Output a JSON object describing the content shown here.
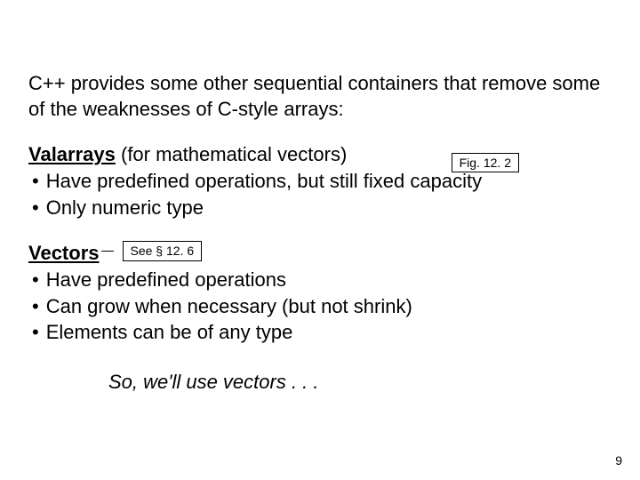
{
  "intro": "C++ provides some other sequential containers that remove some of the weaknesses of C-style arrays:",
  "fig_label": "Fig. 12. 2",
  "valarray": {
    "title": "Valarrays",
    "title_suffix": " (for mathematical vectors)",
    "bullets": [
      "Have predefined operations, but still fixed capacity",
      "Only numeric type"
    ]
  },
  "vectors": {
    "title": "Vectors",
    "see_label": "See § 12. 6",
    "bullets": [
      "Have predefined operations",
      "Can grow when necessary (but not shrink)",
      "Elements can be of any type"
    ]
  },
  "closing": "So, we'll use vectors . . .",
  "page_number": "9"
}
